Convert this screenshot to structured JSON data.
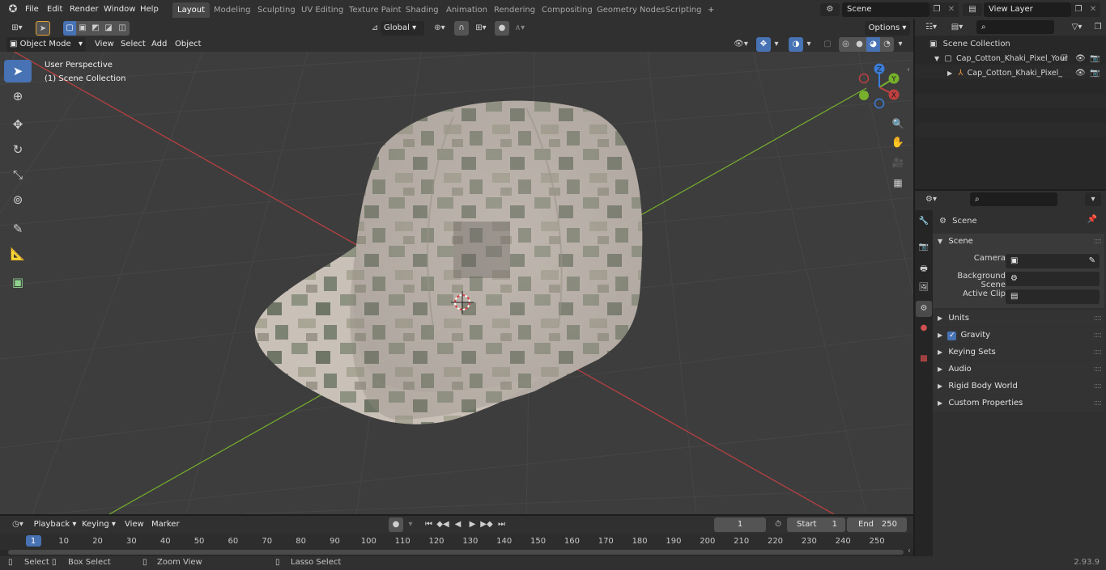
{
  "topbar": {
    "menus": [
      "File",
      "Edit",
      "Render",
      "Window",
      "Help"
    ],
    "workspaces": [
      "Layout",
      "Modeling",
      "Sculpting",
      "UV Editing",
      "Texture Paint",
      "Shading",
      "Animation",
      "Rendering",
      "Compositing",
      "Geometry Nodes",
      "Scripting"
    ],
    "active_workspace": "Layout",
    "add_tab": "+",
    "scene_name": "Scene",
    "view_layer": "View Layer"
  },
  "viewport_header": {
    "mode": "Object Mode",
    "menus": [
      "View",
      "Select",
      "Add",
      "Object"
    ],
    "orientation": "Global",
    "options": "Options"
  },
  "viewport": {
    "perspective_label": "User Perspective",
    "collection_label": "(1) Scene Collection",
    "gizmo": {
      "x": "X",
      "y": "Y",
      "z": "Z"
    }
  },
  "outliner": {
    "root": "Scene Collection",
    "items": [
      "Cap_Cotton_Khaki_Pixel_Your",
      "Cap_Cotton_Khaki_Pixel_"
    ]
  },
  "properties": {
    "context": "Scene",
    "section": "Scene",
    "fields": [
      {
        "label": "Camera",
        "value": ""
      },
      {
        "label": "Background Scene",
        "value": ""
      },
      {
        "label": "Active Clip",
        "value": ""
      }
    ],
    "panels": [
      "Units",
      "Gravity",
      "Keying Sets",
      "Audio",
      "Rigid Body World",
      "Custom Properties"
    ],
    "gravity_checked": true
  },
  "timeline": {
    "menus": [
      "Playback",
      "Keying",
      "View",
      "Marker"
    ],
    "current_frame": "1",
    "start_label": "Start",
    "start": "1",
    "end_label": "End",
    "end": "250",
    "ruler": [
      "1",
      "10",
      "20",
      "30",
      "40",
      "50",
      "60",
      "70",
      "80",
      "90",
      "100",
      "110",
      "120",
      "130",
      "140",
      "150",
      "160",
      "170",
      "180",
      "190",
      "200",
      "210",
      "220",
      "230",
      "240",
      "250"
    ]
  },
  "statusbar": {
    "items": [
      "Select",
      "Box Select",
      "Zoom View",
      "Lasso Select"
    ],
    "version": "2.93.9"
  },
  "colors": {
    "accent": "#4772b3",
    "x_axis": "#c04040",
    "y_axis": "#76b02c",
    "z_axis": "#3b7cd8"
  }
}
